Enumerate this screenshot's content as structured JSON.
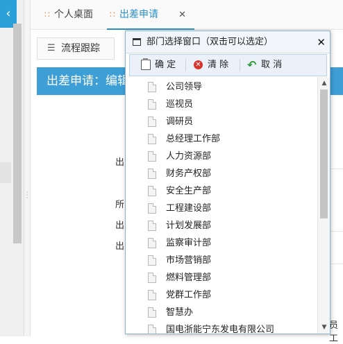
{
  "tabs": [
    {
      "label": "个人桌面"
    },
    {
      "label": "出差申请"
    }
  ],
  "toolbar": {
    "flow_label": "流程跟踪"
  },
  "page": {
    "header": "出差申请：编辑",
    "form_labels": [
      "出",
      "所",
      "出",
      "出"
    ],
    "bottom_right": "员工"
  },
  "dialog": {
    "title": "部门选择窗口（双击可以选定）",
    "ok_label": "确 定",
    "clear_label": "清 除",
    "cancel_label": "取 消",
    "departments": [
      "公司领导",
      "巡视员",
      "调研员",
      "总经理工作部",
      "人力资源部",
      "财务产权部",
      "安全生产部",
      "工程建设部",
      "计划发展部",
      "监察审计部",
      "市场营销部",
      "燃料管理部",
      "党群工作部",
      "智慧办",
      "国电浙能宁东发电有限公司"
    ]
  }
}
